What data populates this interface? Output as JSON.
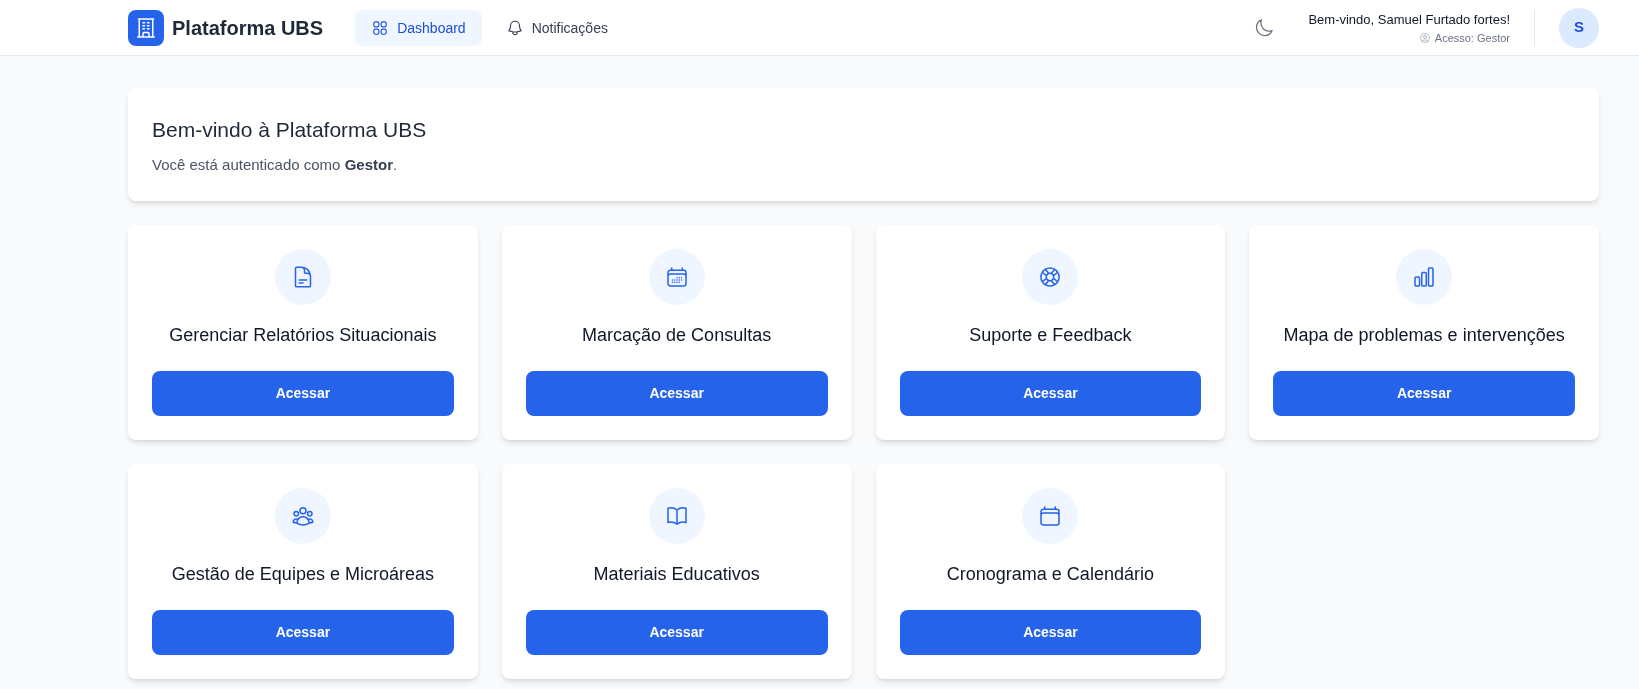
{
  "header": {
    "logo": {
      "title": "Plataforma UBS"
    },
    "nav": [
      {
        "label": "Dashboard",
        "selected": true
      },
      {
        "label": "Notificações",
        "selected": false
      }
    ],
    "user": {
      "greeting": "Bem-vindo, Samuel Furtado fortes!",
      "role": "Acesso: Gestor",
      "avatar_initial": "S"
    }
  },
  "welcome": {
    "title": "Bem-vindo à Plataforma UBS",
    "subtitle": "Você está autenticado como **Gestor**."
  },
  "modules": [
    {
      "title": "Gerenciar Relatórios Situacionais",
      "button": "Acessar"
    },
    {
      "title": "Marcação de Consultas",
      "button": "Acessar"
    },
    {
      "title": "Suporte e Feedback",
      "button": "Acessar"
    },
    {
      "title": "Mapa de problemas e intervenções",
      "button": "Acessar"
    },
    {
      "title": "Gestão de Equipes e Microáreas",
      "button": "Acessar"
    },
    {
      "title": "Materiais Educativos",
      "button": "Acessar"
    },
    {
      "title": "Cronograma e Calendário",
      "button": "Acessar"
    }
  ]
}
